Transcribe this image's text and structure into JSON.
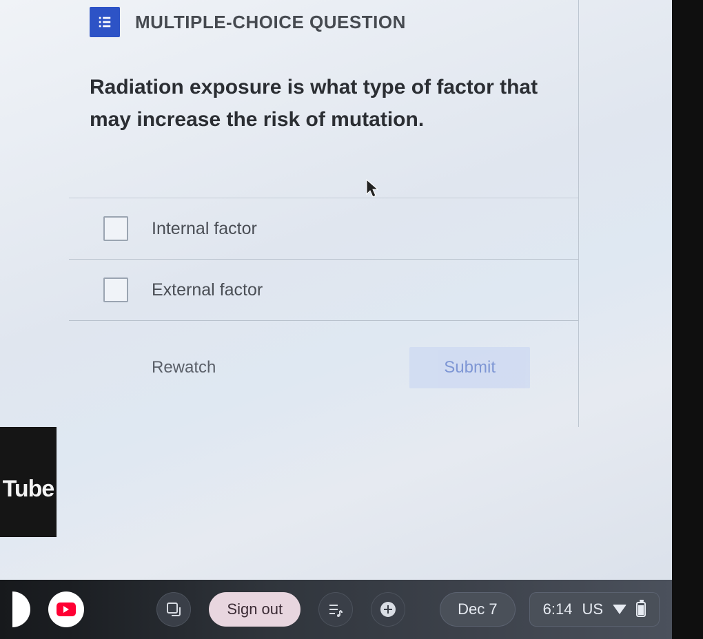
{
  "card": {
    "header_label": "MULTIPLE-CHOICE QUESTION",
    "question_text": "Radiation exposure is what type of factor that may increase the risk of mutation.",
    "options": [
      {
        "label": "Internal factor"
      },
      {
        "label": "External factor"
      }
    ],
    "rewatch_label": "Rewatch",
    "submit_label": "Submit"
  },
  "sidebar": {
    "youtube_fragment": "Tube"
  },
  "shelf": {
    "signout_label": "Sign out",
    "date_label": "Dec 7",
    "time_label": "6:14",
    "locale_label": "US"
  }
}
